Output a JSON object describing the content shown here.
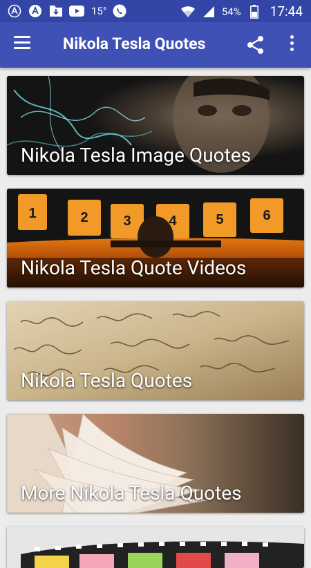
{
  "status_bar": {
    "icons_left": [
      "assistant-a-icon",
      "assistant-a-filled-icon",
      "download-icon",
      "youtube-icon",
      "phone-icon"
    ],
    "temperature": "15°",
    "battery_percent": "54%",
    "time": "17:44",
    "icons_right": [
      "wifi-icon",
      "signal-icon",
      "battery-icon"
    ]
  },
  "app_bar": {
    "title": "Nikola Tesla Quotes",
    "color": "#3f51b5",
    "actions": [
      "menu-icon",
      "share-icon",
      "overflow-icon"
    ]
  },
  "cards": [
    {
      "label": "Nikola Tesla Image Quotes",
      "image": "tesla-portrait-lightning"
    },
    {
      "label": "Nikola Tesla Quote Videos",
      "image": "film-strip-sunset"
    },
    {
      "label": "Nikola Tesla Quotes",
      "image": "handwritten-letter"
    },
    {
      "label": "More Nikola Tesla Quotes",
      "image": "open-book"
    },
    {
      "label": "",
      "image": "film-strip-flowers"
    }
  ]
}
